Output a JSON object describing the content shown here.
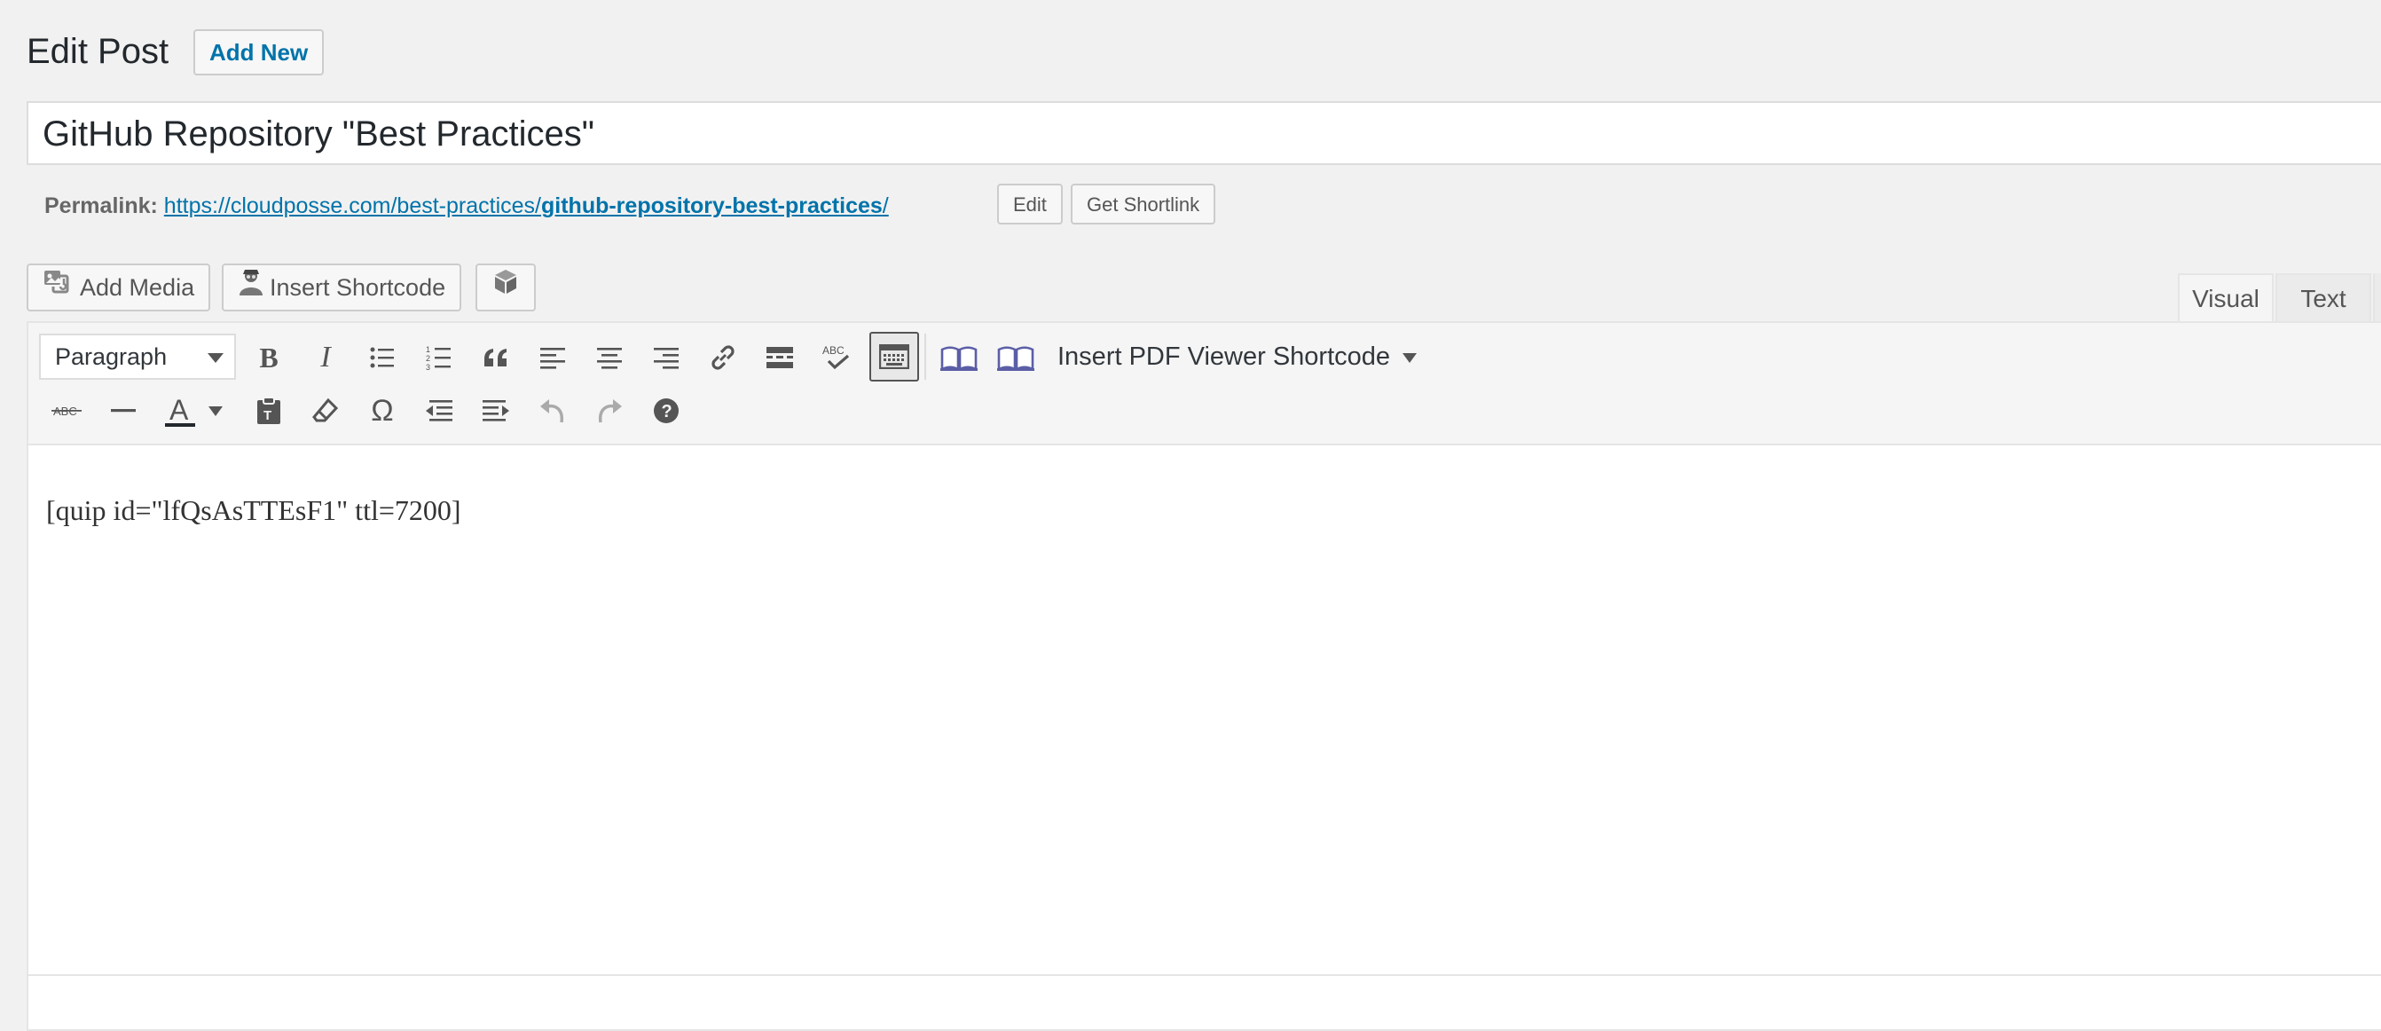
{
  "header": {
    "title": "Edit Post",
    "add_new_label": "Add New"
  },
  "post": {
    "title": "GitHub Repository \"Best Practices\""
  },
  "permalink": {
    "label": "Permalink:",
    "url_base": "https://cloudposse.com/best-practices/",
    "url_slug": "github-repository-best-practices",
    "url_trail": "/",
    "edit_label": "Edit",
    "shortlink_label": "Get Shortlink"
  },
  "media_buttons": {
    "add_media_label": "Add Media",
    "insert_shortcode_label": "Insert Shortcode"
  },
  "editor_tabs": {
    "visual_label": "Visual",
    "text_label": "Text",
    "active": "Visual"
  },
  "toolbar": {
    "format_select_value": "Paragraph",
    "pdf_menu_label": "Insert PDF Viewer Shortcode",
    "row1_icons": [
      "bold-icon",
      "italic-icon",
      "bulleted-list-icon",
      "numbered-list-icon",
      "blockquote-icon",
      "align-left-icon",
      "align-center-icon",
      "align-right-icon",
      "link-icon",
      "read-more-icon",
      "spellcheck-icon",
      "toolbar-toggle-icon",
      "pdf-book-icon",
      "pdf-book-icon-2"
    ],
    "row2_icons": [
      "strikethrough-icon",
      "horizontal-line-icon",
      "text-color-icon",
      "paste-as-text-icon",
      "clear-formatting-icon",
      "special-character-icon",
      "outdent-icon",
      "indent-icon",
      "undo-icon",
      "redo-icon",
      "help-icon"
    ],
    "spellcheck_label": "ABC",
    "strikethrough_label": "ABC",
    "text_color_label": "A",
    "special_char_label": "Ω",
    "text_color_swatch": "#23282d"
  },
  "content": {
    "body": "[quip id=\"lfQsAsTTEsF1\" ttl=7200]"
  },
  "colors": {
    "link": "#0073aa",
    "background": "#f1f1f1",
    "toolbar_icon": "#555555"
  }
}
